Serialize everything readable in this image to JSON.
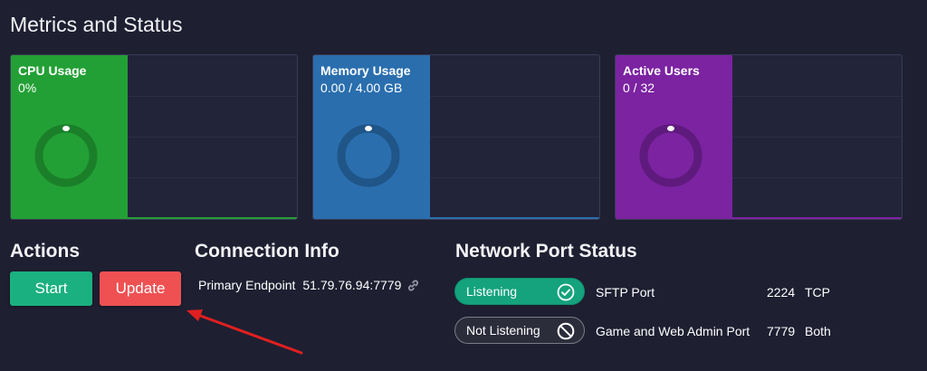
{
  "page_title": "Metrics and Status",
  "metrics": [
    {
      "label": "CPU Usage",
      "value": "0%",
      "color": "#23a035",
      "ring_color": "#1b7f2a",
      "fill": 0
    },
    {
      "label": "Memory Usage",
      "value": "0.00 / 4.00 GB",
      "color": "#2a6eae",
      "ring_color": "#1f5587",
      "fill": 0
    },
    {
      "label": "Active Users",
      "value": "0 / 32",
      "color": "#7b23a1",
      "ring_color": "#5f1a7d",
      "fill": 0
    }
  ],
  "actions": {
    "title": "Actions",
    "start_label": "Start",
    "update_label": "Update"
  },
  "connection": {
    "title": "Connection Info",
    "primary_label": "Primary Endpoint",
    "primary_value": "51.79.76.94:7779",
    "icon": "link-icon"
  },
  "network": {
    "title": "Network Port Status",
    "ports": [
      {
        "status": "Listening",
        "status_icon": "check-circle-icon",
        "name": "SFTP Port",
        "port": "2224",
        "protocol": "TCP"
      },
      {
        "status": "Not Listening",
        "status_icon": "blocked-icon",
        "name": "Game and Web Admin Port",
        "port": "7779",
        "protocol": "Both"
      }
    ]
  },
  "colors": {
    "background": "#1e1f31",
    "start_button": "#1bb07f",
    "update_button": "#ef5153",
    "annotation_arrow": "#e02020"
  }
}
